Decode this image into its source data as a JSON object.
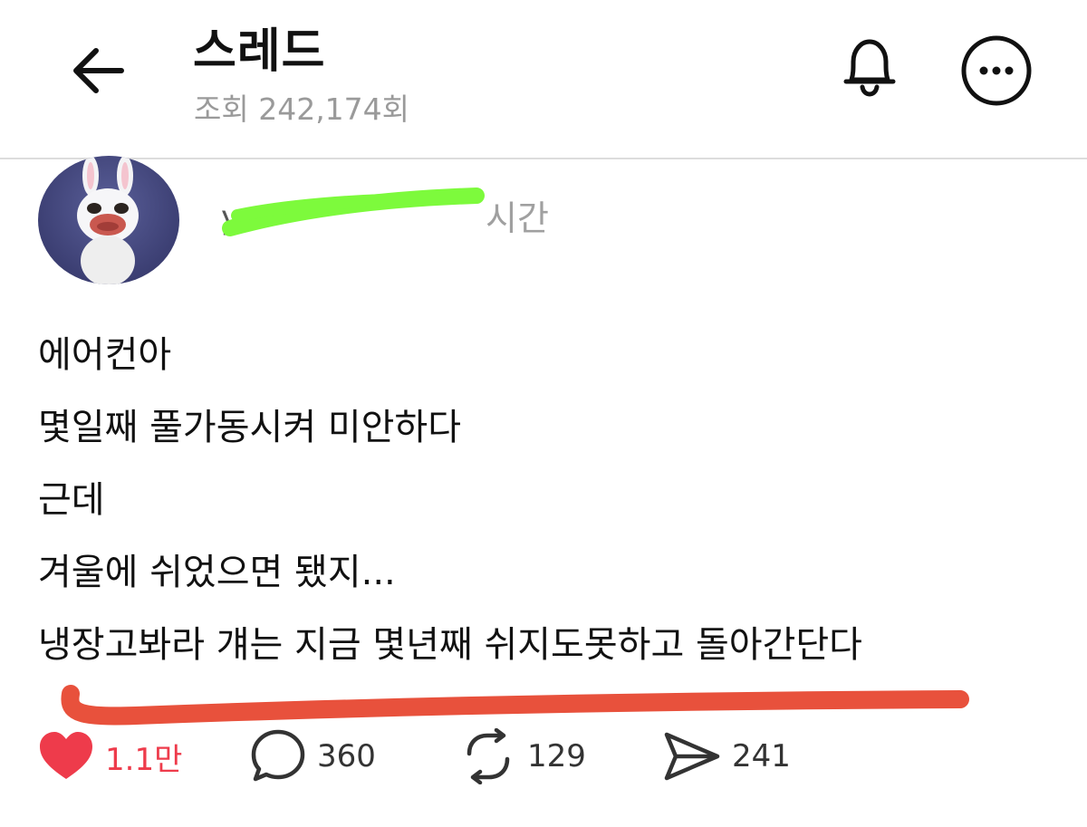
{
  "header": {
    "title": "스레드",
    "views": "조회 242,174회"
  },
  "post": {
    "author_username": "",
    "time_suffix": "시간",
    "lines": [
      "에어컨아",
      "몇일째 풀가동시켜 미안하다",
      "근데",
      "겨울에 쉬었으면 됐지...",
      "냉장고봐라 걔는 지금 몇년째 쉬지도못하고 돌아간단다"
    ]
  },
  "actions": {
    "likes": "1.1만",
    "replies": "360",
    "reposts": "129",
    "shares": "241"
  },
  "colors": {
    "like": "#ee3b4b",
    "redaction_marker": "#7dfa3c",
    "underline_marker": "#e8513c",
    "muted_text": "#9a9a9a"
  },
  "icons": [
    "back-arrow-icon",
    "bell-icon",
    "more-options-icon",
    "heart-icon",
    "comment-icon",
    "repost-icon",
    "share-icon"
  ]
}
